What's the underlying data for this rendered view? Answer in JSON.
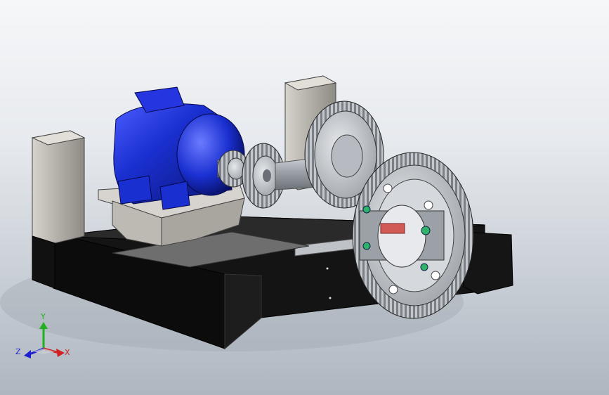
{
  "viewport": {
    "background_top": "#f6f7f9",
    "background_bottom": "#aeb6c0"
  },
  "model": {
    "motor_color": "#1a2fd0",
    "frame_color": "#111111",
    "column_color": "#b9b5ae",
    "gear_color": "#c9cbce",
    "key_color": "#d25a55"
  },
  "triad": {
    "x_label": "X",
    "y_label": "Y",
    "z_label": "Z",
    "x_color": "#d02020",
    "y_color": "#20b020",
    "z_color": "#2020d0"
  }
}
